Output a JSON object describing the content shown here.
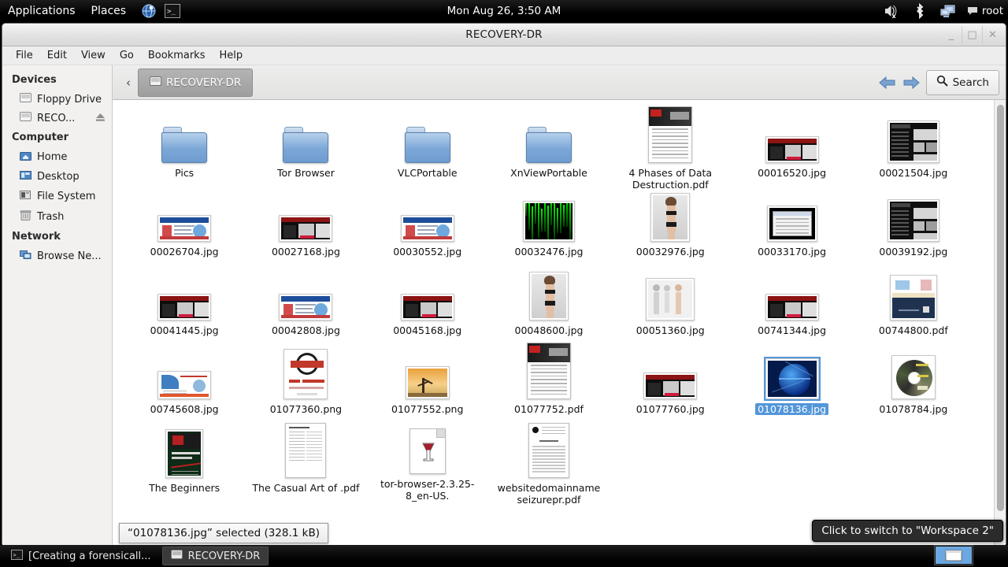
{
  "panel": {
    "menus": [
      {
        "label": "Applications",
        "name": "applications-menu"
      },
      {
        "label": "Places",
        "name": "places-menu"
      }
    ],
    "launchers": [
      {
        "name": "web-browser-icon",
        "title": "Web Browser"
      },
      {
        "name": "terminal-icon",
        "title": "Terminal"
      }
    ],
    "clock": "Mon Aug 26,  3:50 AM",
    "tray": [
      {
        "name": "volume-muted-icon"
      },
      {
        "name": "bluetooth-icon"
      },
      {
        "name": "network-icon"
      }
    ],
    "user": "root"
  },
  "window": {
    "title": "RECOVERY-DR",
    "buttons": {
      "minimize": "_",
      "maximize": "□",
      "close": "✕"
    },
    "menubar": [
      "File",
      "Edit",
      "View",
      "Go",
      "Bookmarks",
      "Help"
    ]
  },
  "sidebar": {
    "sections": [
      {
        "title": "Devices",
        "items": [
          {
            "label": "Floppy Drive",
            "icon": "drive-icon",
            "eject": false
          },
          {
            "label": "RECO...",
            "icon": "drive-icon",
            "eject": true,
            "eject_glyph": "⏏"
          }
        ]
      },
      {
        "title": "Computer",
        "items": [
          {
            "label": "Home",
            "icon": "home-folder-icon",
            "eject": false
          },
          {
            "label": "Desktop",
            "icon": "desktop-icon",
            "eject": false
          },
          {
            "label": "File System",
            "icon": "file-system-icon",
            "eject": false
          },
          {
            "label": "Trash",
            "icon": "trash-icon",
            "eject": false
          }
        ]
      },
      {
        "title": "Network",
        "items": [
          {
            "label": "Browse Ne...",
            "icon": "network-browse-icon",
            "eject": false
          }
        ]
      }
    ]
  },
  "pathbar": {
    "back_chevron": "‹",
    "crumb": "RECOVERY-DR",
    "back_arrow": "back-arrow-icon",
    "forward_arrow": "forward-arrow-icon",
    "search_label": "Search"
  },
  "files": [
    {
      "label": "Pics",
      "kind": "folder"
    },
    {
      "label": "Tor Browser",
      "kind": "folder"
    },
    {
      "label": "VLCPortable",
      "kind": "folder"
    },
    {
      "label": "XnViewPortable",
      "kind": "folder"
    },
    {
      "label": "4 Phases of Data Destruction.pdf",
      "kind": "doc-dark-header"
    },
    {
      "label": "00016520.jpg",
      "kind": "photo-dark-red"
    },
    {
      "label": "00021504.jpg",
      "kind": "photo-dark-site"
    },
    {
      "label": "00026704.jpg",
      "kind": "photo-cert"
    },
    {
      "label": "00027168.jpg",
      "kind": "photo-dark-red"
    },
    {
      "label": "00030552.jpg",
      "kind": "photo-cert"
    },
    {
      "label": "00032476.jpg",
      "kind": "photo-matrix"
    },
    {
      "label": "00032976.jpg",
      "kind": "photo-person"
    },
    {
      "label": "00033170.jpg",
      "kind": "photo-dialog"
    },
    {
      "label": "00039192.jpg",
      "kind": "photo-dark-site"
    },
    {
      "label": "00041445.jpg",
      "kind": "photo-dark-red"
    },
    {
      "label": "00042808.jpg",
      "kind": "photo-cert"
    },
    {
      "label": "00045168.jpg",
      "kind": "photo-dark-red"
    },
    {
      "label": "00048600.jpg",
      "kind": "photo-person"
    },
    {
      "label": "00051360.jpg",
      "kind": "photo-persons2"
    },
    {
      "label": "00741344.jpg",
      "kind": "photo-dark-red"
    },
    {
      "label": "00744800.pdf",
      "kind": "photo-infographic"
    },
    {
      "label": "00745608.jpg",
      "kind": "photo-blue-doc"
    },
    {
      "label": "01077360.png",
      "kind": "photo-badge"
    },
    {
      "label": "01077552.png",
      "kind": "photo-sunset"
    },
    {
      "label": "01077752.pdf",
      "kind": "doc-dark-header"
    },
    {
      "label": "01077760.jpg",
      "kind": "photo-dark-red"
    },
    {
      "label": "01078136.jpg",
      "kind": "photo-blue-globe",
      "selected": true
    },
    {
      "label": "01078784.jpg",
      "kind": "photo-cd"
    },
    {
      "label": "The Beginners",
      "kind": "photo-book"
    },
    {
      "label": "The Casual Art of .pdf",
      "kind": "doc-text"
    },
    {
      "label": "tor-browser-2.3.25-8_en-US.",
      "kind": "wine-exe"
    },
    {
      "label": "websitedomainname seizurepr.pdf",
      "kind": "doc-text2"
    }
  ],
  "status": {
    "text": "“01078136.jpg” selected (328.1 kB)"
  },
  "taskbar": {
    "tasks": [
      {
        "label": "[Creating a forensicall...",
        "icon": "terminal-icon",
        "active": false
      },
      {
        "label": "RECOVERY-DR",
        "icon": "drive-icon",
        "active": true
      }
    ],
    "workspace_tooltip": "Click to switch to \"Workspace 2\""
  },
  "colors": {
    "selection_blue": "#5396d9",
    "panel_black": "#000000",
    "window_gray": "#ededed"
  }
}
